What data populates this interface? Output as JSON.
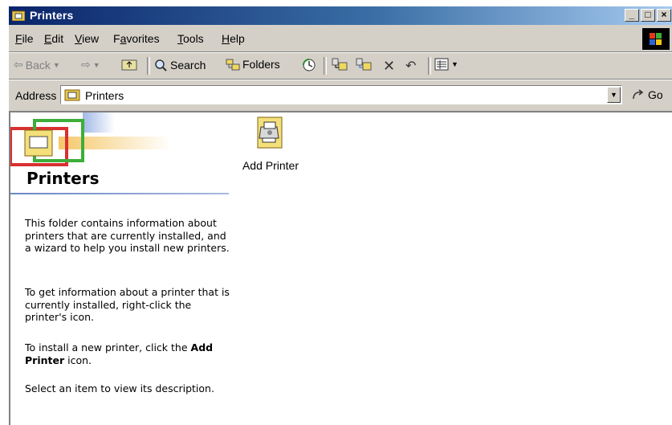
{
  "window": {
    "title": "Printers",
    "buttons": {
      "minimize": "_",
      "maximize": "□",
      "close": "×"
    }
  },
  "menu": {
    "items": [
      {
        "label": "File",
        "accel": "F"
      },
      {
        "label": "Edit",
        "accel": "E"
      },
      {
        "label": "View",
        "accel": "V"
      },
      {
        "label": "Favorites",
        "accel": "a"
      },
      {
        "label": "Tools",
        "accel": "T"
      },
      {
        "label": "Help",
        "accel": "H"
      }
    ]
  },
  "toolbar": {
    "back_label": "Back",
    "search_label": "Search",
    "folders_label": "Folders"
  },
  "address": {
    "label": "Address",
    "value": "Printers",
    "go_label": "Go"
  },
  "left_pane": {
    "title": "Printers",
    "para1": "This folder contains information about printers that are currently installed, and a wizard to help you install new printers.",
    "para2": "To get information about a printer that is currently installed, right-click the printer's icon.",
    "para3_before": "To install a new printer, click the ",
    "para3_bold": "Add Printer",
    "para3_after": " icon.",
    "para4": "Select an item to view its description."
  },
  "items": [
    {
      "label": "Add Printer",
      "icon": "add-printer-icon"
    }
  ],
  "colors": {
    "titlebar_start": "#0a246a",
    "titlebar_end": "#a6caf0",
    "chrome": "#d4d0c8"
  }
}
